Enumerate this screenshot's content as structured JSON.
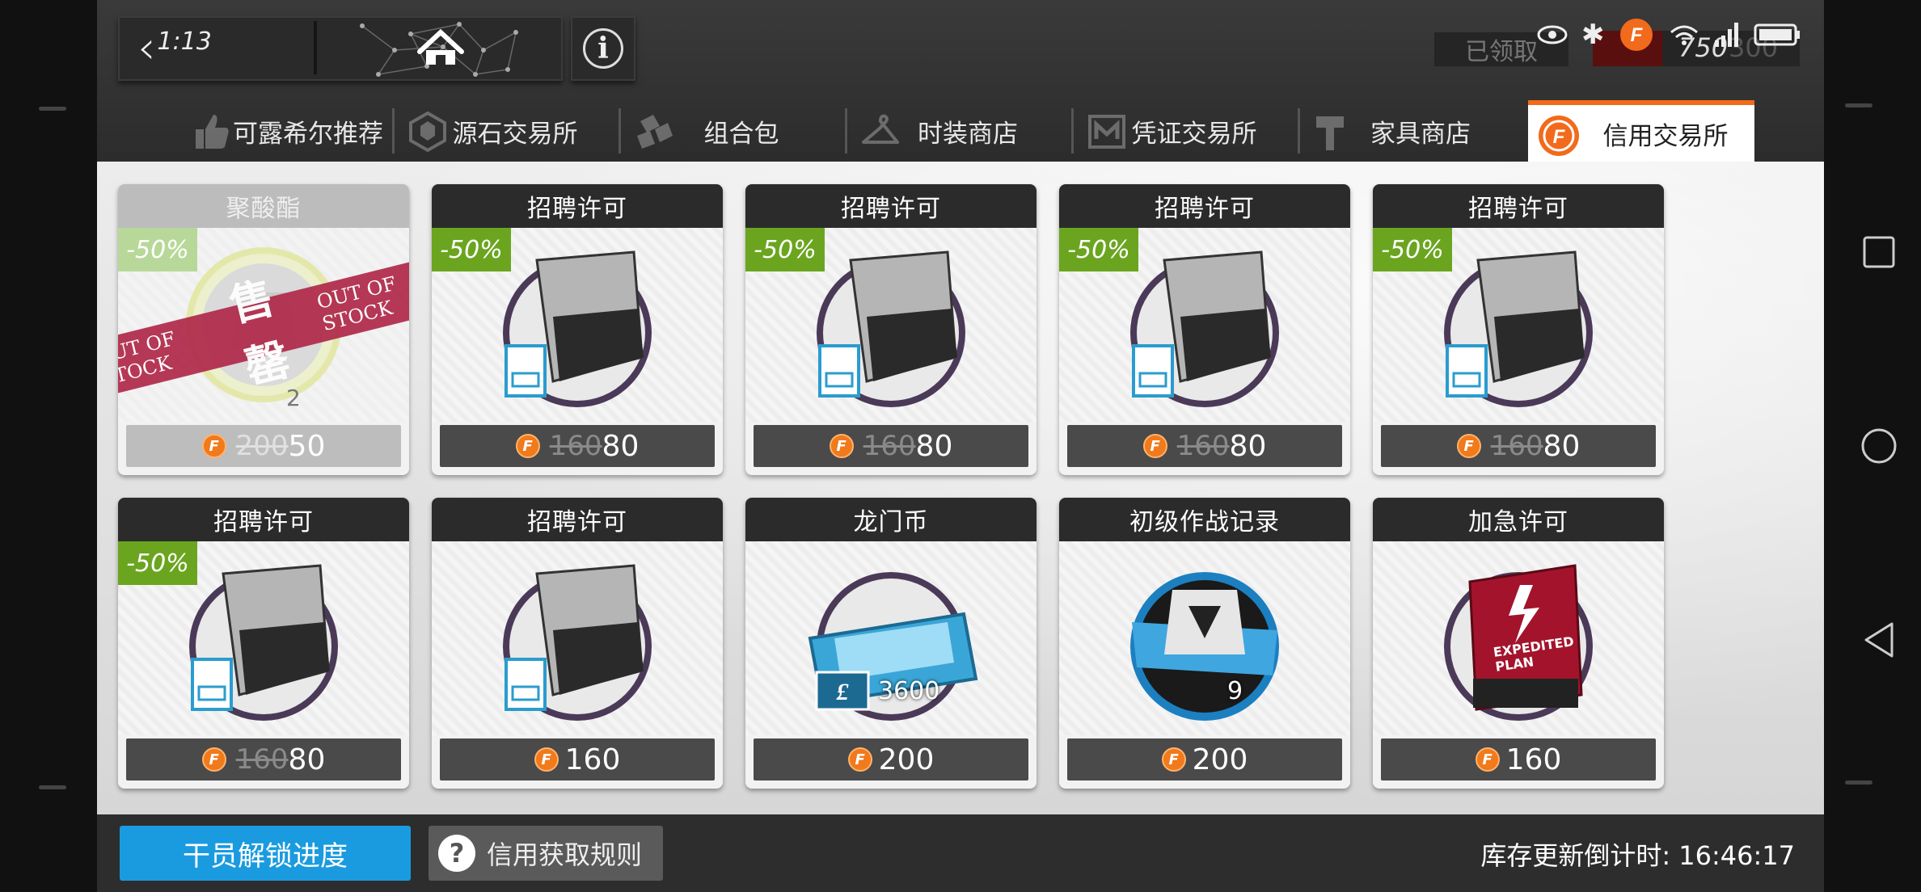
{
  "header": {
    "back_number": "1:13",
    "claimed_label": "已领取",
    "credit_value": "750",
    "credit_max": "300"
  },
  "tabs": [
    {
      "label": "可露希尔推荐",
      "icon": "thumbs-up-icon"
    },
    {
      "label": "源石交易所",
      "icon": "originite-icon"
    },
    {
      "label": "组合包",
      "icon": "bundle-icon"
    },
    {
      "label": "时装商店",
      "icon": "hanger-icon"
    },
    {
      "label": "凭证交易所",
      "icon": "voucher-icon"
    },
    {
      "label": "家具商店",
      "icon": "hammer-icon"
    },
    {
      "label": "信用交易所",
      "icon": "credit-icon",
      "active": true
    }
  ],
  "credit_symbol": "F",
  "cards": [
    {
      "title": "聚酸酯",
      "badge": "-50%",
      "old": "200",
      "new": "50",
      "sold_out": true,
      "sold_en": "OUT OF STOCK",
      "sold_zh": "售罄",
      "qty": "2"
    },
    {
      "title": "招聘许可",
      "badge": "-50%",
      "old": "160",
      "new": "80"
    },
    {
      "title": "招聘许可",
      "badge": "-50%",
      "old": "160",
      "new": "80"
    },
    {
      "title": "招聘许可",
      "badge": "-50%",
      "old": "160",
      "new": "80"
    },
    {
      "title": "招聘许可",
      "badge": "-50%",
      "old": "160",
      "new": "80"
    },
    {
      "title": "招聘许可",
      "badge": "-50%",
      "old": "160",
      "new": "80"
    },
    {
      "title": "招聘许可",
      "price": "160"
    },
    {
      "title": "龙门币",
      "price": "200",
      "qty": "3600"
    },
    {
      "title": "初级作战记录",
      "price": "200",
      "qty": "9"
    },
    {
      "title": "加急许可",
      "price": "160",
      "item_text": "EXPEDITED PLAN"
    }
  ],
  "footer": {
    "unlock_label": "干员解锁进度",
    "rules_label": "信用获取规则",
    "refresh_label": "库存更新倒计时:",
    "refresh_time": "16:46:17"
  },
  "colors": {
    "credit_orange": "#f26a1b",
    "discount_green": "#6ba51f",
    "unlock_blue": "#1a9be0"
  }
}
